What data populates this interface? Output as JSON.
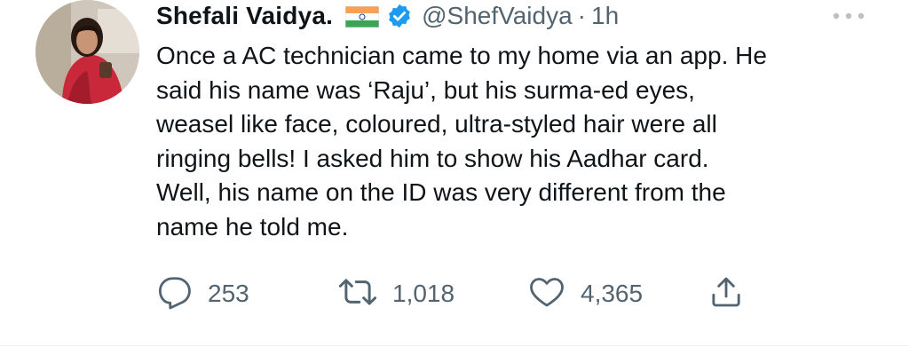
{
  "tweet": {
    "author": {
      "display_name": "Shefali Vaidya.",
      "flag_icon": "india-flag-icon",
      "verified_icon": "verified-badge-icon",
      "handle": "@ShefVaidya",
      "separator": "·",
      "time": "1h"
    },
    "text_lines": [
      "Once a AC technician came to my home via an app. He",
      "said his name was ‘Raju’, but his surma-ed eyes,",
      "weasel like face, coloured, ultra-styled hair were all",
      "ringing bells! I asked him to show his Aadhar card.",
      "Well, his name on the ID was very different from the",
      "name he told me."
    ],
    "actions": {
      "reply": {
        "icon": "reply-icon",
        "count": "253"
      },
      "retweet": {
        "icon": "retweet-icon",
        "count": "1,018"
      },
      "like": {
        "icon": "heart-icon",
        "count": "4,365"
      },
      "share": {
        "icon": "share-icon"
      }
    },
    "more_icon": "more-options-icon"
  },
  "colors": {
    "text_primary": "#0f1419",
    "text_secondary": "#536471",
    "verified_blue": "#1d9bf0",
    "divider": "#eff3f4"
  }
}
